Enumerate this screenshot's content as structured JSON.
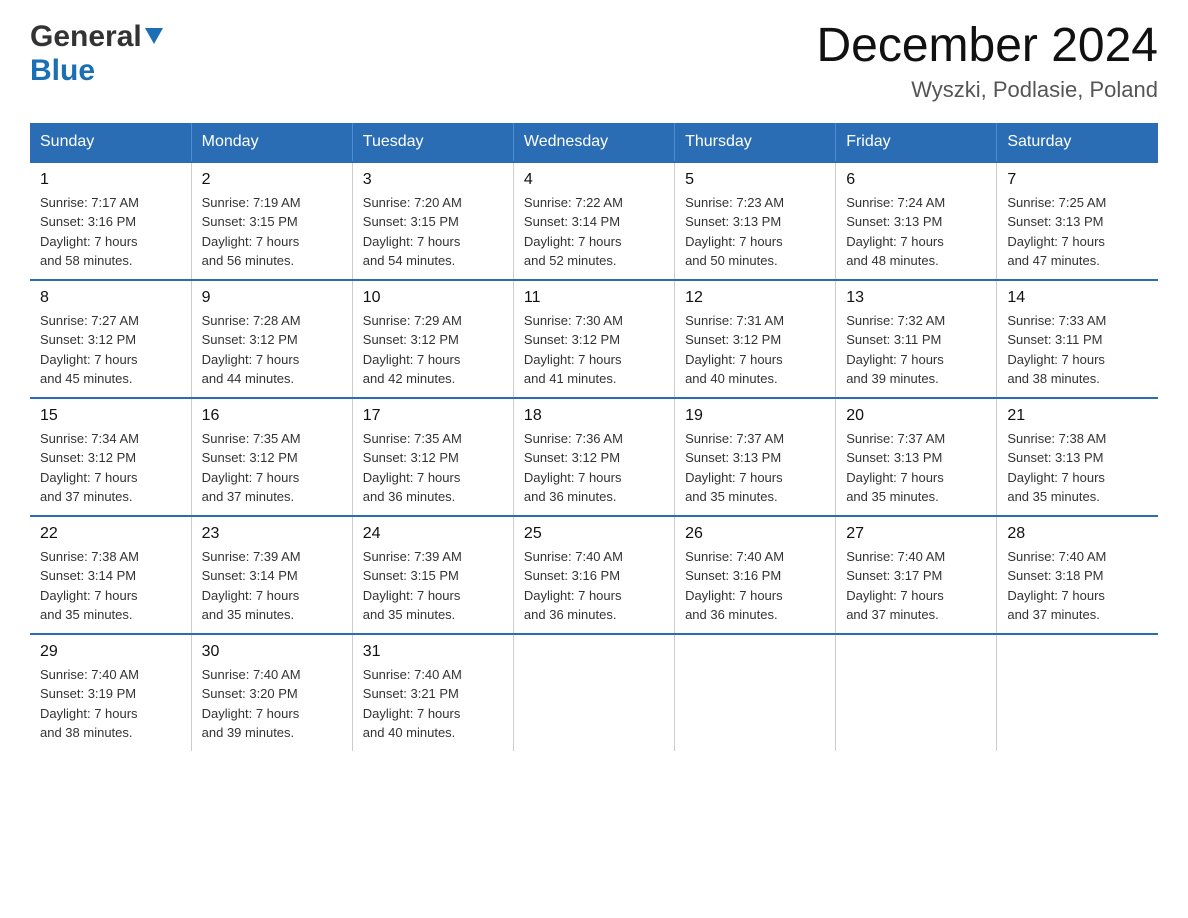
{
  "header": {
    "logo_general": "General",
    "logo_blue": "Blue",
    "title": "December 2024",
    "subtitle": "Wyszki, Podlasie, Poland"
  },
  "days_of_week": [
    "Sunday",
    "Monday",
    "Tuesday",
    "Wednesday",
    "Thursday",
    "Friday",
    "Saturday"
  ],
  "weeks": [
    [
      {
        "day": "1",
        "sunrise": "7:17 AM",
        "sunset": "3:16 PM",
        "daylight": "7 hours and 58 minutes."
      },
      {
        "day": "2",
        "sunrise": "7:19 AM",
        "sunset": "3:15 PM",
        "daylight": "7 hours and 56 minutes."
      },
      {
        "day": "3",
        "sunrise": "7:20 AM",
        "sunset": "3:15 PM",
        "daylight": "7 hours and 54 minutes."
      },
      {
        "day": "4",
        "sunrise": "7:22 AM",
        "sunset": "3:14 PM",
        "daylight": "7 hours and 52 minutes."
      },
      {
        "day": "5",
        "sunrise": "7:23 AM",
        "sunset": "3:13 PM",
        "daylight": "7 hours and 50 minutes."
      },
      {
        "day": "6",
        "sunrise": "7:24 AM",
        "sunset": "3:13 PM",
        "daylight": "7 hours and 48 minutes."
      },
      {
        "day": "7",
        "sunrise": "7:25 AM",
        "sunset": "3:13 PM",
        "daylight": "7 hours and 47 minutes."
      }
    ],
    [
      {
        "day": "8",
        "sunrise": "7:27 AM",
        "sunset": "3:12 PM",
        "daylight": "7 hours and 45 minutes."
      },
      {
        "day": "9",
        "sunrise": "7:28 AM",
        "sunset": "3:12 PM",
        "daylight": "7 hours and 44 minutes."
      },
      {
        "day": "10",
        "sunrise": "7:29 AM",
        "sunset": "3:12 PM",
        "daylight": "7 hours and 42 minutes."
      },
      {
        "day": "11",
        "sunrise": "7:30 AM",
        "sunset": "3:12 PM",
        "daylight": "7 hours and 41 minutes."
      },
      {
        "day": "12",
        "sunrise": "7:31 AM",
        "sunset": "3:12 PM",
        "daylight": "7 hours and 40 minutes."
      },
      {
        "day": "13",
        "sunrise": "7:32 AM",
        "sunset": "3:11 PM",
        "daylight": "7 hours and 39 minutes."
      },
      {
        "day": "14",
        "sunrise": "7:33 AM",
        "sunset": "3:11 PM",
        "daylight": "7 hours and 38 minutes."
      }
    ],
    [
      {
        "day": "15",
        "sunrise": "7:34 AM",
        "sunset": "3:12 PM",
        "daylight": "7 hours and 37 minutes."
      },
      {
        "day": "16",
        "sunrise": "7:35 AM",
        "sunset": "3:12 PM",
        "daylight": "7 hours and 37 minutes."
      },
      {
        "day": "17",
        "sunrise": "7:35 AM",
        "sunset": "3:12 PM",
        "daylight": "7 hours and 36 minutes."
      },
      {
        "day": "18",
        "sunrise": "7:36 AM",
        "sunset": "3:12 PM",
        "daylight": "7 hours and 36 minutes."
      },
      {
        "day": "19",
        "sunrise": "7:37 AM",
        "sunset": "3:13 PM",
        "daylight": "7 hours and 35 minutes."
      },
      {
        "day": "20",
        "sunrise": "7:37 AM",
        "sunset": "3:13 PM",
        "daylight": "7 hours and 35 minutes."
      },
      {
        "day": "21",
        "sunrise": "7:38 AM",
        "sunset": "3:13 PM",
        "daylight": "7 hours and 35 minutes."
      }
    ],
    [
      {
        "day": "22",
        "sunrise": "7:38 AM",
        "sunset": "3:14 PM",
        "daylight": "7 hours and 35 minutes."
      },
      {
        "day": "23",
        "sunrise": "7:39 AM",
        "sunset": "3:14 PM",
        "daylight": "7 hours and 35 minutes."
      },
      {
        "day": "24",
        "sunrise": "7:39 AM",
        "sunset": "3:15 PM",
        "daylight": "7 hours and 35 minutes."
      },
      {
        "day": "25",
        "sunrise": "7:40 AM",
        "sunset": "3:16 PM",
        "daylight": "7 hours and 36 minutes."
      },
      {
        "day": "26",
        "sunrise": "7:40 AM",
        "sunset": "3:16 PM",
        "daylight": "7 hours and 36 minutes."
      },
      {
        "day": "27",
        "sunrise": "7:40 AM",
        "sunset": "3:17 PM",
        "daylight": "7 hours and 37 minutes."
      },
      {
        "day": "28",
        "sunrise": "7:40 AM",
        "sunset": "3:18 PM",
        "daylight": "7 hours and 37 minutes."
      }
    ],
    [
      {
        "day": "29",
        "sunrise": "7:40 AM",
        "sunset": "3:19 PM",
        "daylight": "7 hours and 38 minutes."
      },
      {
        "day": "30",
        "sunrise": "7:40 AM",
        "sunset": "3:20 PM",
        "daylight": "7 hours and 39 minutes."
      },
      {
        "day": "31",
        "sunrise": "7:40 AM",
        "sunset": "3:21 PM",
        "daylight": "7 hours and 40 minutes."
      },
      null,
      null,
      null,
      null
    ]
  ],
  "labels": {
    "sunrise": "Sunrise:",
    "sunset": "Sunset:",
    "daylight": "Daylight:"
  }
}
